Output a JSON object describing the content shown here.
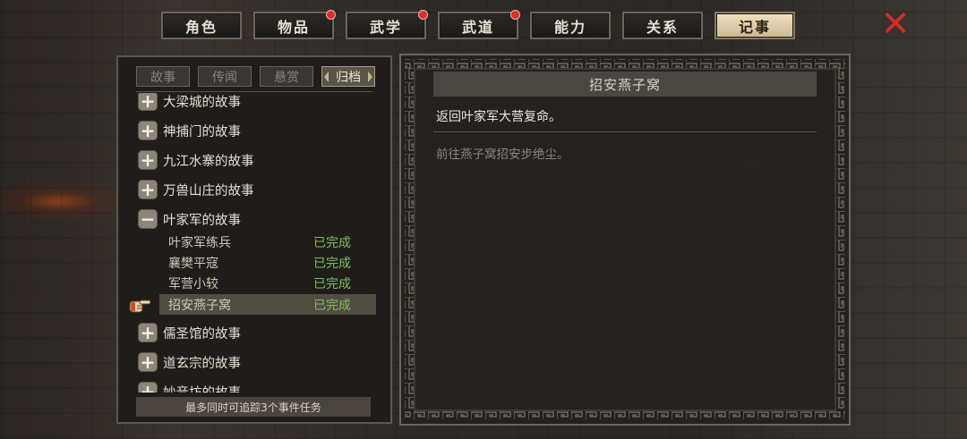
{
  "tabs": [
    {
      "label": "角色",
      "badge": false
    },
    {
      "label": "物品",
      "badge": true
    },
    {
      "label": "武学",
      "badge": true
    },
    {
      "label": "武道",
      "badge": true
    },
    {
      "label": "能力",
      "badge": false
    },
    {
      "label": "关系",
      "badge": false
    },
    {
      "label": "记事",
      "badge": false,
      "active": true
    }
  ],
  "close_icon": "close-x-icon",
  "subtabs": [
    {
      "label": "故事"
    },
    {
      "label": "传闻"
    },
    {
      "label": "悬赏"
    },
    {
      "label": "归档",
      "active": true
    }
  ],
  "categories": [
    {
      "label": "大梁城的故事",
      "expanded": false
    },
    {
      "label": "神捕门的故事",
      "expanded": false
    },
    {
      "label": "九江水寨的故事",
      "expanded": false
    },
    {
      "label": "万兽山庄的故事",
      "expanded": false
    },
    {
      "label": "叶家军的故事",
      "expanded": true
    },
    {
      "label": "儒圣馆的故事",
      "expanded": false
    },
    {
      "label": "道玄宗的故事",
      "expanded": false
    },
    {
      "label": "妙音坊的故事",
      "expanded": false
    }
  ],
  "subitems": [
    {
      "name": "叶家军练兵",
      "status": "已完成"
    },
    {
      "name": "襄樊平寇",
      "status": "已完成"
    },
    {
      "name": "军营小较",
      "status": "已完成"
    },
    {
      "name": "招安燕子窝",
      "status": "已完成",
      "selected": true
    }
  ],
  "footer_text": "最多同时可追踪3个事件任务",
  "detail": {
    "title": "招安燕子窝",
    "description": "返回叶家军大营复命。",
    "objective": "前往燕子窝招安步绝尘。"
  },
  "colors": {
    "completed": "#7fc05a",
    "active_tab": "#e3d3b1",
    "badge": "#d8302c",
    "close": "#c4322c"
  }
}
